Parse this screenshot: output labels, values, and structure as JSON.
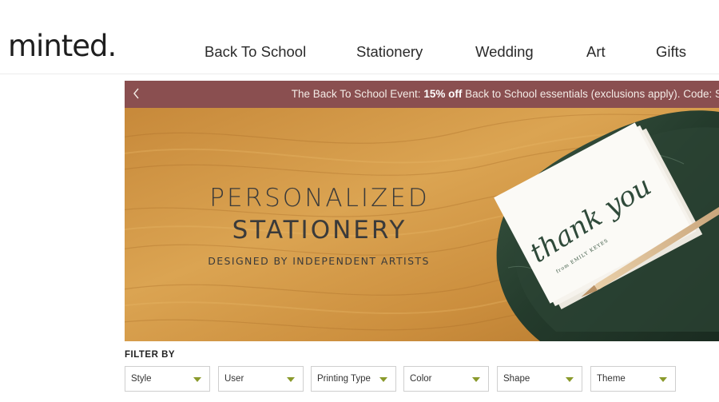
{
  "header": {
    "logo": "minted.",
    "nav": [
      "Back To School",
      "Stationery",
      "Wedding",
      "Art",
      "Gifts"
    ]
  },
  "promo": {
    "prefix": "The Back To School Event: ",
    "highlight": "15% off",
    "suffix": " Back to School essentials (exclusions apply). Code: S",
    "arrow_icon": "chevron-left-icon"
  },
  "hero": {
    "title_line1": "PERSONALIZED",
    "title_line2": "STATIONERY",
    "subtitle": "DESIGNED BY INDEPENDENT ARTISTS",
    "card_script": "thank you",
    "card_small": "from EMILY KEYES"
  },
  "filters": {
    "heading": "FILTER BY",
    "items": [
      "Style",
      "User",
      "Printing Type",
      "Color",
      "Shape",
      "Theme"
    ]
  },
  "colors": {
    "promo_bg": "#8a4f50",
    "caret": "#8a9a2c",
    "wood": "#d29846"
  }
}
